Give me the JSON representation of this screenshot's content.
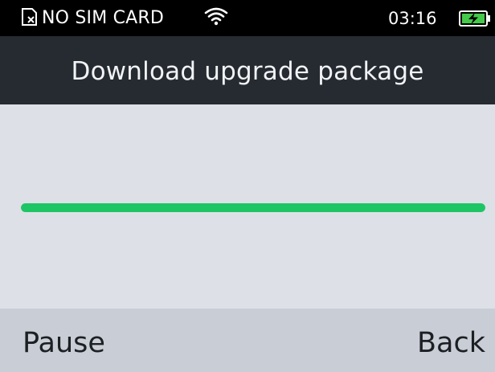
{
  "status_bar": {
    "sim_icon": "no-sim-icon",
    "sim_text": "NO SIM CARD",
    "wifi_icon": "wifi-icon",
    "time": "03:16",
    "battery_icon": "battery-charging-icon"
  },
  "title_bar": {
    "title": "Download upgrade package"
  },
  "progress": {
    "value": 1.0,
    "color": "#1ec564"
  },
  "softkeys": {
    "left_label": "Pause",
    "right_label": "Back"
  },
  "colors": {
    "status_bar_bg": "#000000",
    "title_bar_bg": "#262b32",
    "content_bg": "#dde1e7",
    "softkey_bar_bg": "#c9ced6"
  }
}
